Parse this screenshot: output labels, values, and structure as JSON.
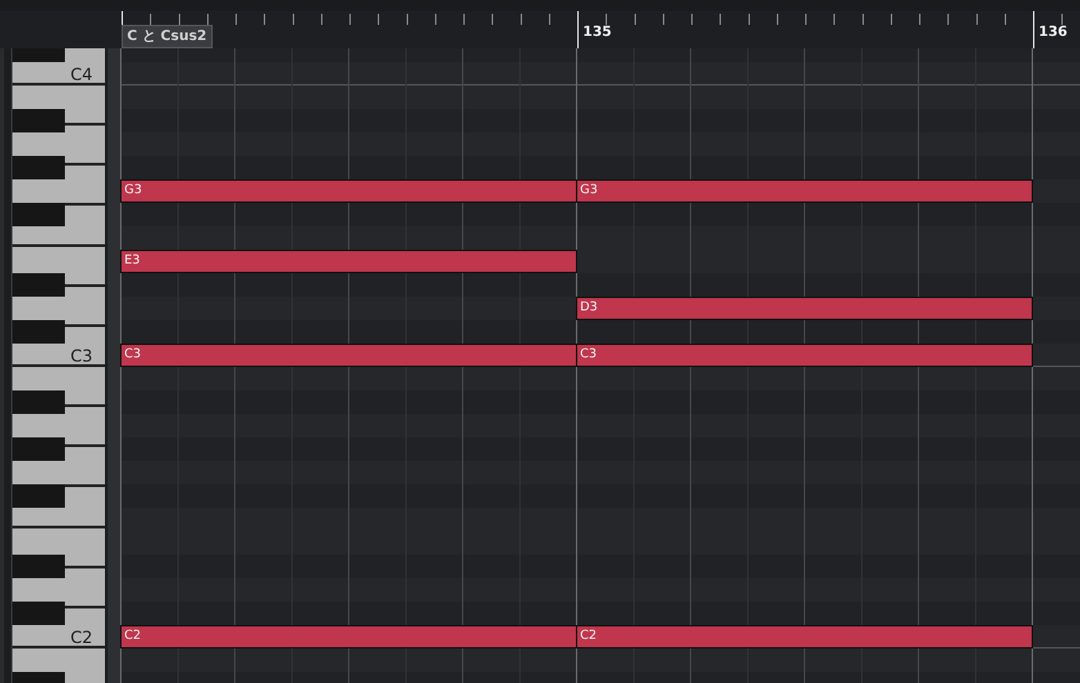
{
  "ruler": {
    "marker": "C と Csus2",
    "bar_labels": [
      "135",
      "136"
    ]
  },
  "rows": [
    {
      "kind": "black"
    },
    {
      "kind": "white",
      "label": "C4"
    },
    {
      "kind": "white"
    },
    {
      "kind": "black"
    },
    {
      "kind": "white"
    },
    {
      "kind": "black"
    },
    {
      "kind": "white",
      "bar_1_note": "G3",
      "bar_2_note": "G3"
    },
    {
      "kind": "black"
    },
    {
      "kind": "white"
    },
    {
      "kind": "white",
      "bar_1_note": "E3"
    },
    {
      "kind": "black"
    },
    {
      "kind": "white",
      "bar_2_note": "D3"
    },
    {
      "kind": "black"
    },
    {
      "kind": "white",
      "label": "C3",
      "bar_1_note": "C3",
      "bar_2_note": "C3"
    },
    {
      "kind": "white"
    },
    {
      "kind": "black"
    },
    {
      "kind": "white"
    },
    {
      "kind": "black"
    },
    {
      "kind": "white"
    },
    {
      "kind": "black"
    },
    {
      "kind": "white"
    },
    {
      "kind": "white"
    },
    {
      "kind": "black"
    },
    {
      "kind": "white"
    },
    {
      "kind": "black"
    },
    {
      "kind": "white",
      "label": "C2",
      "bar_1_note": "C2",
      "bar_2_note": "C2"
    },
    {
      "kind": "white"
    },
    {
      "kind": "black"
    }
  ]
}
